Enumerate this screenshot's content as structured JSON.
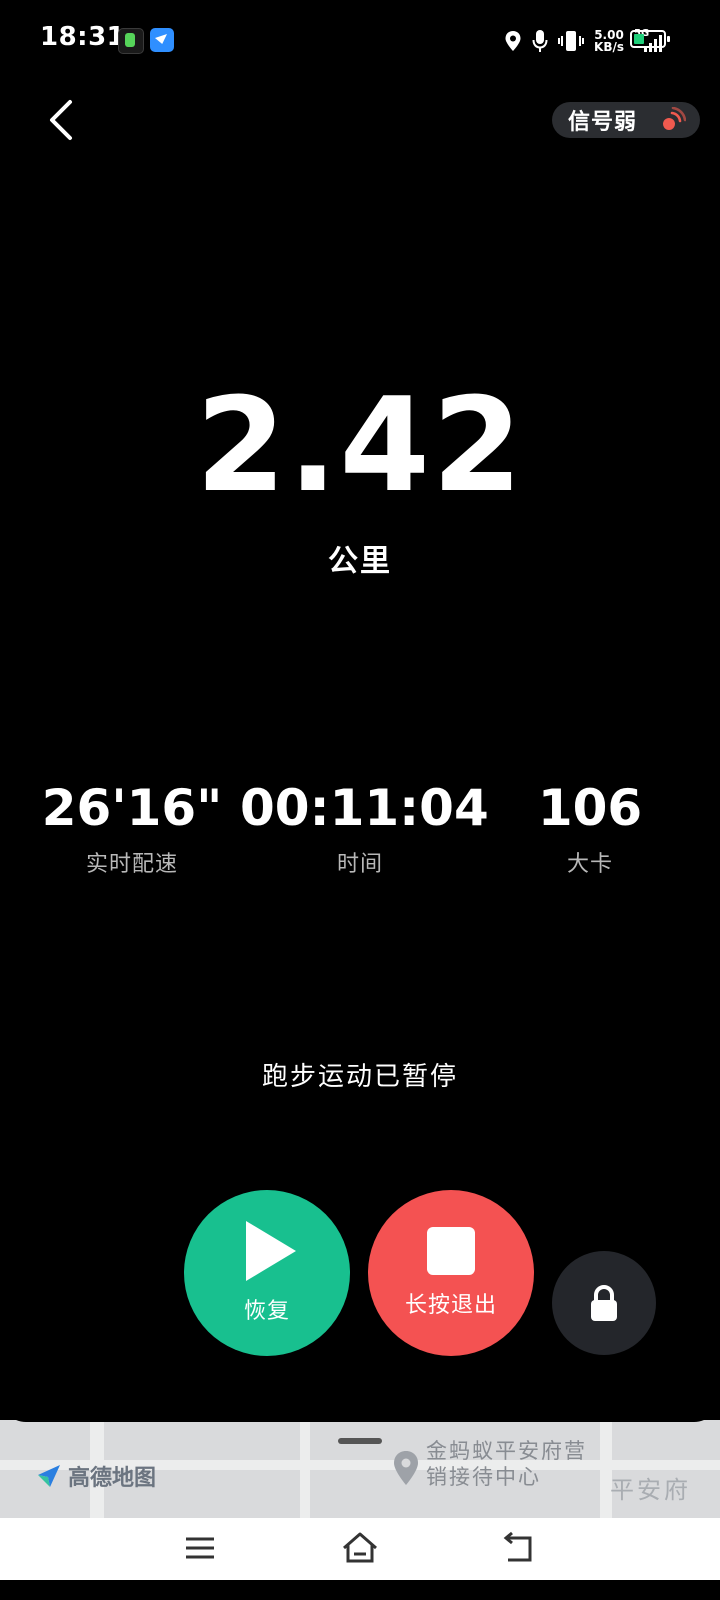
{
  "status_bar": {
    "time": "18:31",
    "net_speed_value": "5.00",
    "net_speed_unit": "KB/s",
    "network_type": "5G"
  },
  "header": {
    "signal_status": "信号弱"
  },
  "distance": {
    "value": "2.42",
    "unit": "公里"
  },
  "stats": {
    "pace": {
      "value": "26'16\"",
      "label": "实时配速"
    },
    "time": {
      "value": "00:11:04",
      "label": "时间"
    },
    "calories": {
      "value": "106",
      "label": "大卡"
    }
  },
  "status_message": "跑步运动已暂停",
  "controls": {
    "resume_label": "恢复",
    "stop_label": "长按退出"
  },
  "map": {
    "brand": "高德地图",
    "poi_name": "金蚂蚁平安府营销接待中心",
    "area_label": "平安府"
  },
  "colors": {
    "resume": "#18c08f",
    "stop": "#f45252",
    "lock": "#24262b",
    "signal_warning": "#f05a4f"
  }
}
